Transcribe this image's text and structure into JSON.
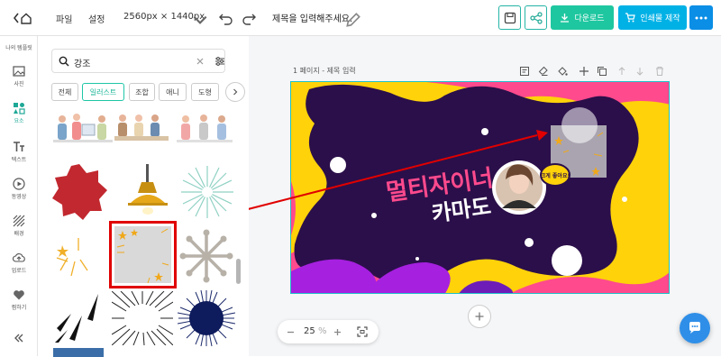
{
  "topbar": {
    "file_menu": "파일",
    "settings_menu": "설정",
    "size": "2560px × 1440px",
    "title": "제목을 입력해주세요.",
    "download": "다운로드",
    "print": "인쇄물 제작"
  },
  "rail": {
    "top_label": "나의 템플릿",
    "items": [
      {
        "label": "사진",
        "icon": "image-icon"
      },
      {
        "label": "요소",
        "icon": "elements-icon"
      },
      {
        "label": "텍스트",
        "icon": "text-icon"
      },
      {
        "label": "동영상",
        "icon": "video-icon"
      },
      {
        "label": "배경",
        "icon": "background-icon"
      },
      {
        "label": "업로드",
        "icon": "upload-icon"
      },
      {
        "label": "찜하기",
        "icon": "heart-icon"
      }
    ],
    "active_item": "요소"
  },
  "panel": {
    "search_value": "강조",
    "chips": [
      "전체",
      "일러스트",
      "조합",
      "애니",
      "도형"
    ],
    "active_chip": "일러스트"
  },
  "canvas": {
    "page_label": "1 페이지 - 제목 입력",
    "design_title_line1": "멀티자이너",
    "design_title_line2": "카마도",
    "bubble_text": "크게 좋아요!",
    "zoom": "25",
    "zoom_unit": "%"
  },
  "colors": {
    "accent": "#1fc7a0",
    "print_button": "#00b1e6",
    "art_yellow": "#ffd20a",
    "art_purple": "#2b0f4a",
    "art_pink": "#ff4a8d",
    "art_violet": "#a620e0",
    "highlight_red": "#e00000"
  }
}
